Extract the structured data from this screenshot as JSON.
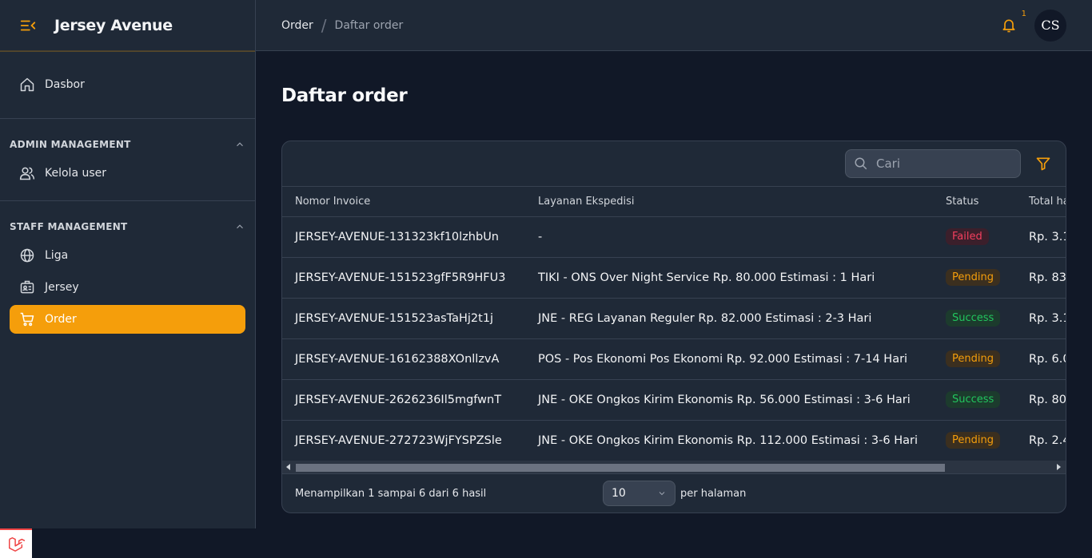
{
  "brand": {
    "title": "Jersey Avenue"
  },
  "sidebar": {
    "dashboard": "Dasbor",
    "groups": [
      {
        "heading": "ADMIN MANAGEMENT",
        "items": [
          "Kelola user"
        ]
      },
      {
        "heading": "STAFF MANAGEMENT",
        "items": [
          "Liga",
          "Jersey",
          "Order"
        ]
      }
    ],
    "active_item": "Order"
  },
  "breadcrumb": {
    "parent": "Order",
    "current": "Daftar order"
  },
  "notifications": {
    "count": "1"
  },
  "user": {
    "initials": "CS"
  },
  "page": {
    "title": "Daftar order"
  },
  "search": {
    "placeholder": "Cari"
  },
  "table": {
    "columns": [
      "Nomor Invoice",
      "Layanan Ekspedisi",
      "Status",
      "Total ha"
    ],
    "rows": [
      {
        "invoice": "JERSEY-AVENUE-131323kf10lzhbUn",
        "shipping": "-",
        "status": "Failed",
        "total": "Rp. 3.1"
      },
      {
        "invoice": "JERSEY-AVENUE-151523gfF5R9HFU3",
        "shipping": "TIKI - ONS Over Night Service Rp. 80.000 Estimasi : 1 Hari",
        "status": "Pending",
        "total": "Rp. 83"
      },
      {
        "invoice": "JERSEY-AVENUE-151523asTaHj2t1j",
        "shipping": "JNE - REG Layanan Reguler Rp. 82.000 Estimasi : 2-3 Hari",
        "status": "Success",
        "total": "Rp. 3.1"
      },
      {
        "invoice": "JERSEY-AVENUE-16162388XOnllzvA",
        "shipping": "POS - Pos Ekonomi Pos Ekonomi Rp. 92.000 Estimasi : 7-14 Hari",
        "status": "Pending",
        "total": "Rp. 6.0"
      },
      {
        "invoice": "JERSEY-AVENUE-2626236Il5mgfwnT",
        "shipping": "JNE - OKE Ongkos Kirim Ekonomis Rp. 56.000 Estimasi : 3-6 Hari",
        "status": "Success",
        "total": "Rp. 80"
      },
      {
        "invoice": "JERSEY-AVENUE-272723WjFYSPZSle",
        "shipping": "JNE - OKE Ongkos Kirim Ekonomis Rp. 112.000 Estimasi : 3-6 Hari",
        "status": "Pending",
        "total": "Rp. 2.4"
      }
    ]
  },
  "pagination": {
    "summary": "Menampilkan 1 sampai 6 dari 6 hasil",
    "per_page_value": "10",
    "per_page_label": "per halaman"
  },
  "colors": {
    "accent": "#f59e0b",
    "failed": "#f43f5e",
    "success": "#22c55e"
  },
  "icons": [
    "menu-collapse-icon",
    "home-icon",
    "users-icon",
    "globe-icon",
    "id-card-icon",
    "cart-icon",
    "bell-icon",
    "search-icon",
    "filter-icon",
    "chevron-up-icon",
    "chevron-down-icon",
    "laravel-icon"
  ]
}
